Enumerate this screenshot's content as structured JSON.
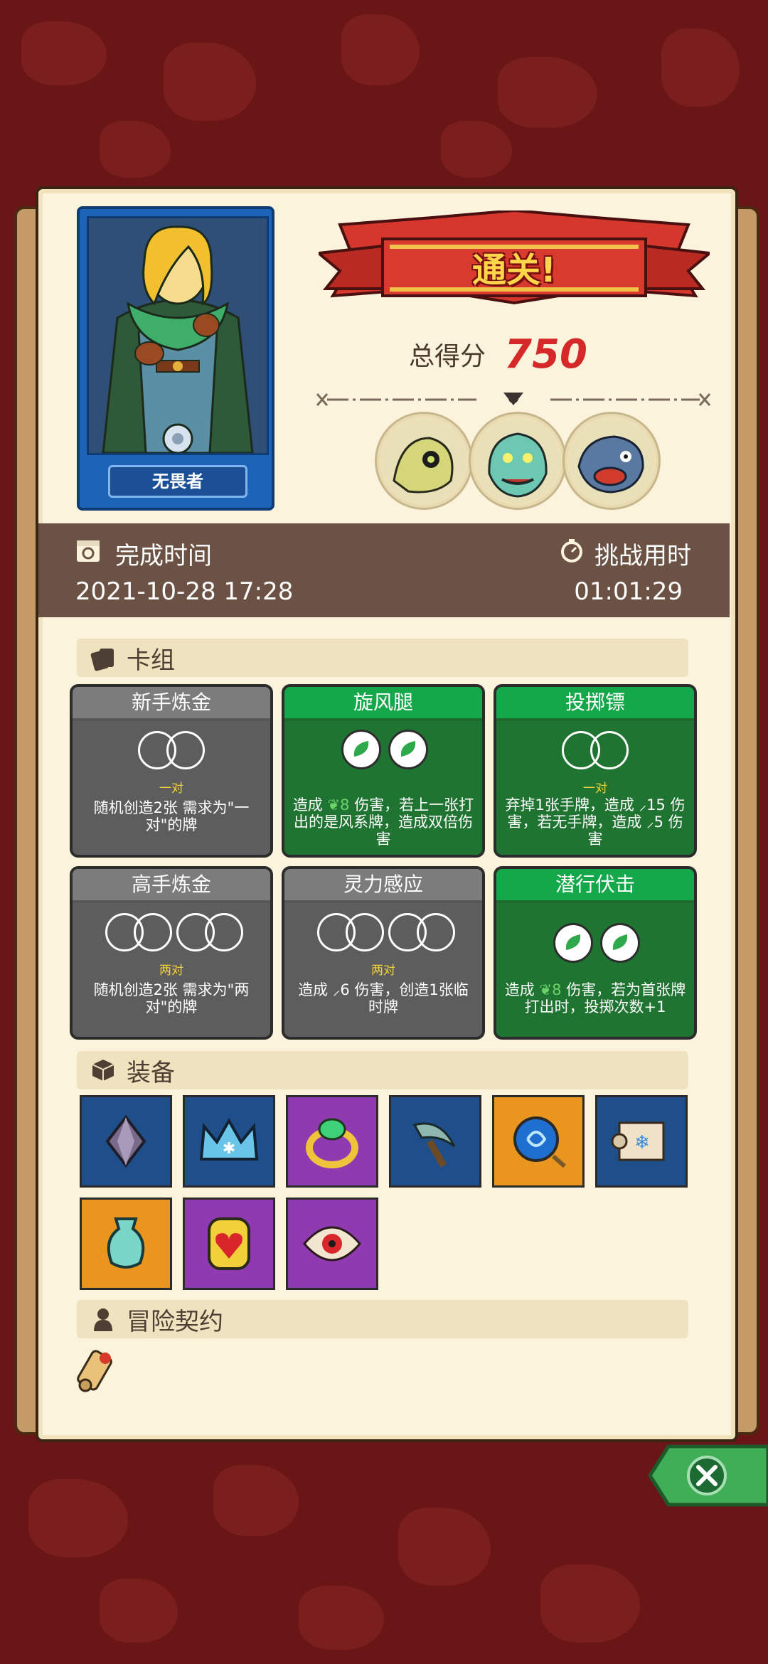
{
  "result": {
    "title": "通关!",
    "score_label": "总得分",
    "score_value": "750"
  },
  "hero": {
    "name": "无畏者"
  },
  "info": {
    "finish_time_label": "完成时间",
    "finish_time_value": "2021-10-28 17:28",
    "challenge_time_label": "挑战用时",
    "challenge_time_value": "01:01:29"
  },
  "bosses": [
    "bone-dragon-portrait",
    "sea-monster-portrait",
    "fish-beast-portrait"
  ],
  "deck": {
    "header": "卡组",
    "cards": [
      {
        "title": "新手炼金",
        "tag": "一对",
        "desc": "随机创造2张 需求为\"一对\"的牌",
        "color": "gray"
      },
      {
        "title": "旋风腿",
        "tag": "",
        "desc_pre": "造成 ",
        "desc_num": "8",
        "desc_post": " 伤害，若上一张打出的是风系牌，造成双倍伤害",
        "color": "green"
      },
      {
        "title": "投掷镖",
        "tag": "一对",
        "desc_a": "弃掉1张手牌，造成 ",
        "desc_num1": "15",
        "desc_b": " 伤害，若无手牌，造成 ",
        "desc_num2": "5",
        "desc_c": " 伤害",
        "color": "green"
      },
      {
        "title": "高手炼金",
        "tag": "两对",
        "desc": "随机创造2张 需求为\"两对\"的牌",
        "color": "gray"
      },
      {
        "title": "灵力感应",
        "tag": "两对",
        "desc_pre": "造成 ",
        "desc_num": "6",
        "desc_post": " 伤害，创造1张临时牌",
        "color": "gray"
      },
      {
        "title": "潜行伏击",
        "tag": "",
        "desc_pre": "造成 ",
        "desc_num": "8",
        "desc_post": " 伤害，若为首张牌打出时，投掷次数+1",
        "color": "green"
      }
    ]
  },
  "equipment": {
    "header": "装备",
    "items": [
      {
        "icon": "crystal-icon",
        "bg": "blue"
      },
      {
        "icon": "ice-crown-icon",
        "bg": "blue"
      },
      {
        "icon": "emerald-ring-icon",
        "bg": "purple"
      },
      {
        "icon": "sickle-icon",
        "bg": "blue"
      },
      {
        "icon": "water-orb-icon",
        "bg": "orange"
      },
      {
        "icon": "frost-scroll-icon",
        "bg": "blue"
      },
      {
        "icon": "jade-vase-icon",
        "bg": "orange"
      },
      {
        "icon": "heart-amulet-icon",
        "bg": "purple"
      },
      {
        "icon": "fire-eye-icon",
        "bg": "purple"
      }
    ]
  },
  "contract": {
    "header": "冒险契约",
    "items": [
      "scroll-icon"
    ]
  },
  "colors": {
    "background": "#6b1616",
    "paper": "#fbf3dc",
    "info_bar": "#6b5245",
    "score": "#d62828",
    "card_green": "#1c6b2d",
    "card_gray": "#575757"
  }
}
